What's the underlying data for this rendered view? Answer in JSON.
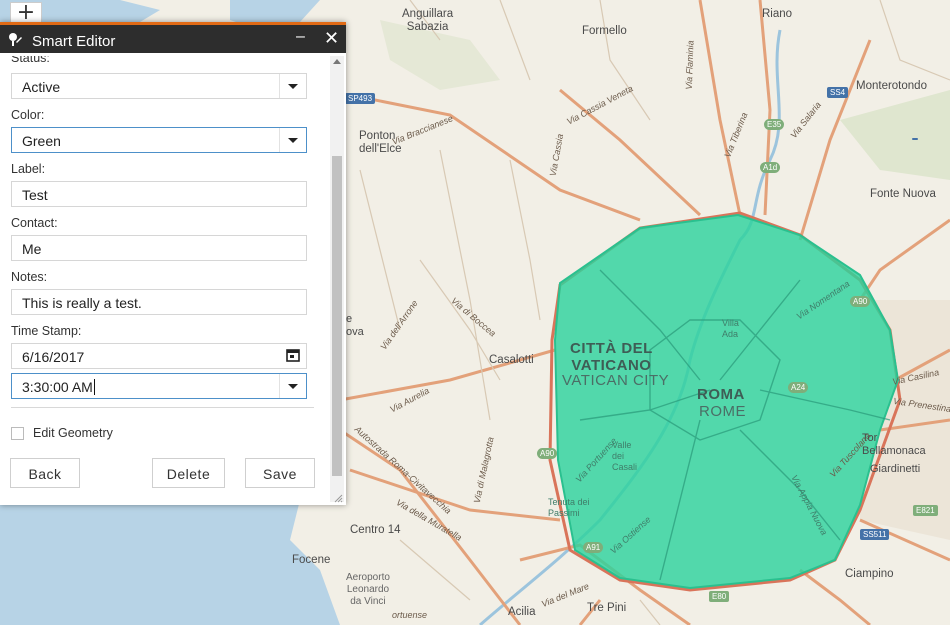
{
  "map": {
    "places": {
      "anguillara": "Anguillara\nSabazia",
      "riano": "Riano",
      "formello": "Formello",
      "monterotondo": "Monterotondo",
      "ponton": "Ponton\ndell'Elce",
      "fonte_nuova": "Fonte Nuova",
      "casalotti": "Casalotti",
      "vaticano": "CITTÀ DEL\nVATICANO",
      "vatican_city": "VATICAN CITY",
      "roma": "ROMA",
      "rome": "ROME",
      "villa_ada": "Villa\nAda",
      "valle": "Valle\ndei\nCasali",
      "tenuta": "Tenuta dei\nPassimi",
      "tor": "Tor\nBellamonaca",
      "giardinetti": "Giardinetti",
      "centro14": "Centro 14",
      "focene": "Focene",
      "aeroporto": "Aeroporto\nLeonardo\nda Vinci",
      "ciampino": "Ciampino",
      "acilia": "Acilia",
      "trepini": "Tre Pini",
      "ova": "e\nova",
      "ortuense": "ortuense"
    },
    "roads": {
      "braccianese": "Via Braccianese",
      "cassia": "Via Cassia",
      "cassia_veneta": "Via Cassia Veneta",
      "flaminia": "Via Flaminia",
      "tiberina": "Via Tiberina",
      "salaria": "Via Salaria",
      "aurelia": "Via Aurelia",
      "boccea": "Via di Boccea",
      "arrone": "Via dell'Arrone",
      "portuense": "Via Portuense",
      "muratella": "Via della Muratella",
      "tuscolana": "Via Tuscolana",
      "appia": "Via Appia Nuova",
      "casilina": "Via Casilina",
      "prenestina": "Via Prenestina",
      "ostiense": "Via Ostiense",
      "nomentana": "Via Nomentana",
      "autostrada": "Autostrada Roma-Civitavecchia",
      "malagrotta": "Via di Malagrotta",
      "del_mare": "Via del Mare"
    },
    "shields": {
      "sp493": "SP493",
      "ss4": "SS4",
      "e35": "E35",
      "a1d": "A1d",
      "a90": "A90",
      "a90b": "A90",
      "a24": "A24",
      "a91": "A91",
      "e80": "E80",
      "e821": "E821",
      "ss511": "SS511"
    },
    "zoom_in_label": "+",
    "roma_area_color": "#2ed39e"
  },
  "editor": {
    "title": "Smart Editor",
    "minimize_label": "–",
    "close_label": "✕",
    "status_label": "Status:",
    "status_value": "Active",
    "color_label": "Color:",
    "color_value": "Green",
    "label_label": "Label:",
    "label_value": "Test",
    "contact_label": "Contact:",
    "contact_value": "Me",
    "notes_label": "Notes:",
    "notes_value": "This is really a test.",
    "timestamp_label": "Time Stamp:",
    "date_value": "6/16/2017",
    "time_value": "3:30:00 AM",
    "edit_geometry_label": "Edit Geometry",
    "back_label": "Back",
    "delete_label": "Delete",
    "save_label": "Save"
  }
}
